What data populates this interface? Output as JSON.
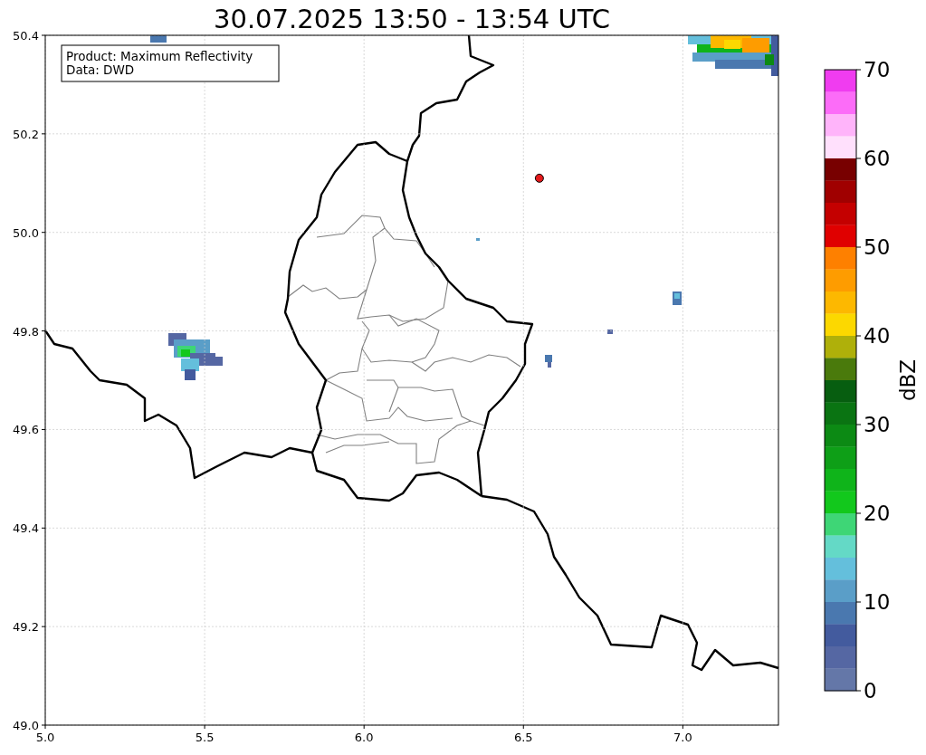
{
  "figure": {
    "title": "30.07.2025 13:50 - 13:54 UTC"
  },
  "map": {
    "info_box": [
      "Product: Maximum Reflectivity",
      "Data: DWD"
    ],
    "chart_data": {
      "type": "scatter",
      "grid": true,
      "xlim": [
        5.0,
        7.3
      ],
      "ylim": [
        49.0,
        50.4
      ],
      "xticks": [
        {
          "value": 5.0,
          "label": "5.0"
        },
        {
          "value": 5.5,
          "label": "5.5"
        },
        {
          "value": 6.0,
          "label": "6.0"
        },
        {
          "value": 6.5,
          "label": "6.5"
        },
        {
          "value": 7.0,
          "label": "7.0"
        }
      ],
      "yticks": [
        {
          "value": 49.0,
          "label": "49.0"
        },
        {
          "value": 49.2,
          "label": "49.2"
        },
        {
          "value": 49.4,
          "label": "49.4"
        },
        {
          "value": 49.6,
          "label": "49.6"
        },
        {
          "value": 49.8,
          "label": "49.8"
        },
        {
          "value": 50.0,
          "label": "50.0"
        },
        {
          "value": 50.2,
          "label": "50.2"
        },
        {
          "value": 50.4,
          "label": "50.4"
        }
      ],
      "x": [
        6.55
      ],
      "series": [
        {
          "color": "#e31a1c",
          "values": [
            50.11
          ]
        }
      ]
    }
  },
  "colorbar": {
    "label": "dBZ",
    "ticks": [
      "70",
      "60",
      "50",
      "40",
      "30",
      "20",
      "10",
      "0"
    ],
    "bins": [
      {
        "color": "#f03cf0"
      },
      {
        "color": "#fc6cf8"
      },
      {
        "color": "#ffb4fa"
      },
      {
        "color": "#ffe0fc"
      },
      {
        "color": "#780000"
      },
      {
        "color": "#a00000"
      },
      {
        "color": "#c40000"
      },
      {
        "color": "#e00000"
      },
      {
        "color": "#fe8000"
      },
      {
        "color": "#fe9c00"
      },
      {
        "color": "#fdb800"
      },
      {
        "color": "#fcd800"
      },
      {
        "color": "#afb00a"
      },
      {
        "color": "#4a7a0c"
      },
      {
        "color": "#075e10"
      },
      {
        "color": "#0a7412"
      },
      {
        "color": "#0c8a14"
      },
      {
        "color": "#0e9f17"
      },
      {
        "color": "#0fb41a"
      },
      {
        "color": "#12c81c"
      },
      {
        "color": "#3ed676"
      },
      {
        "color": "#64d9c6"
      },
      {
        "color": "#64bfdc"
      },
      {
        "color": "#5a9ec8"
      },
      {
        "color": "#4a78af"
      },
      {
        "color": "#435b9e"
      },
      {
        "color": "#5567a3"
      },
      {
        "color": "#6477a8"
      }
    ]
  }
}
